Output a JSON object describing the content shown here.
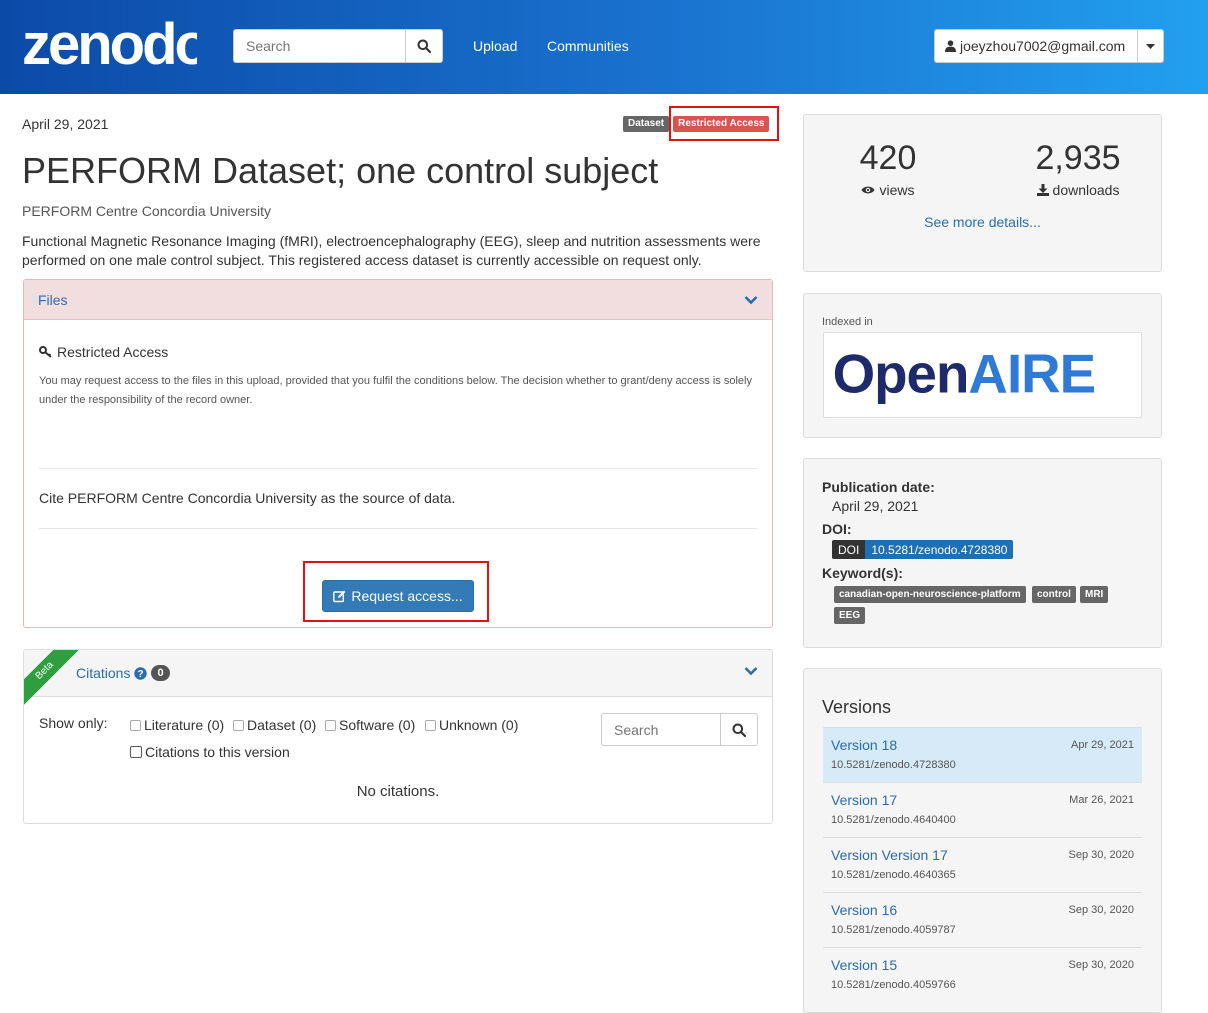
{
  "header": {
    "logo_text": "zenodo",
    "search_placeholder": "Search",
    "nav": [
      "Upload",
      "Communities"
    ],
    "user_email": "joeyzhou7002@gmail.com",
    "colors": {
      "gradient_start": "#0c4aa8",
      "gradient_end": "#22a0ef"
    }
  },
  "record": {
    "date": "April 29, 2021",
    "badges": [
      "Dataset",
      "Restricted Access"
    ],
    "title": "PERFORM Dataset; one control subject",
    "creator": "PERFORM Centre Concordia University",
    "description": "Functional Magnetic Resonance Imaging (fMRI), electroencephalography (EEG), sleep and nutrition assessments were performed on one male control subject. This registered access dataset is currently accessible on request only."
  },
  "files": {
    "heading": "Files",
    "restricted_title": "Restricted Access",
    "restricted_text": "You may request access to the files in this upload, provided that you fulfil the conditions below. The decision whether to grant/deny access is solely under the responsibility of the record owner.",
    "conditions": "Cite PERFORM Centre Concordia University as the source of data.",
    "request_button": "Request access..."
  },
  "citations": {
    "ribbon": "Beta",
    "heading": "Citations",
    "count": "0",
    "show_only": "Show only:",
    "filters": [
      "Literature (0)",
      "Dataset (0)",
      "Software (0)",
      "Unknown (0)",
      "Citations to this version"
    ],
    "search_placeholder": "Search",
    "empty": "No citations."
  },
  "sidebar": {
    "stats": {
      "views": "420",
      "views_label": "views",
      "downloads": "2,935",
      "downloads_label": "downloads",
      "more": "See more details..."
    },
    "indexed_in": "Indexed in",
    "openaire_logo": {
      "part1": "Open",
      "part2": "AIRE"
    },
    "publication_date_label": "Publication date:",
    "publication_date": "April 29, 2021",
    "doi_label": "DOI:",
    "doi_prefix": "DOI",
    "doi": "10.5281/zenodo.4728380",
    "keywords_label": "Keyword(s):",
    "keywords": [
      "canadian-open-neuroscience-platform",
      "control",
      "MRI",
      "EEG"
    ],
    "versions_title": "Versions",
    "versions": [
      {
        "name": "Version 18",
        "doi": "10.5281/zenodo.4728380",
        "date": "Apr 29, 2021"
      },
      {
        "name": "Version 17",
        "doi": "10.5281/zenodo.4640400",
        "date": "Mar 26, 2021"
      },
      {
        "name": "Version Version 17",
        "doi": "10.5281/zenodo.4640365",
        "date": "Sep 30, 2020"
      },
      {
        "name": "Version 16",
        "doi": "10.5281/zenodo.4059787",
        "date": "Sep 30, 2020"
      },
      {
        "name": "Version 15",
        "doi": "10.5281/zenodo.4059766",
        "date": "Sep 30, 2020"
      }
    ]
  }
}
